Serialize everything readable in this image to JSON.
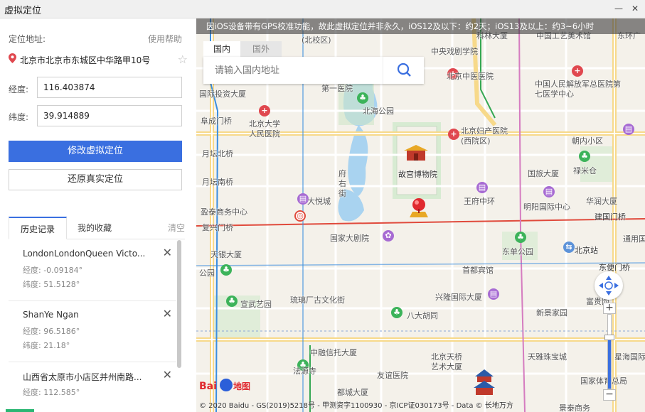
{
  "window": {
    "title": "虚拟定位",
    "min_label": "—",
    "close_label": "✕"
  },
  "location": {
    "label": "定位地址:",
    "help": "使用帮助",
    "address": "北京市北京市东城区中华路甲10号",
    "lng_label": "经度:",
    "lng_value": "116.403874",
    "lat_label": "纬度:",
    "lat_value": "39.914889"
  },
  "buttons": {
    "modify": "修改虚拟定位",
    "restore": "还原真实定位"
  },
  "tabs": {
    "history": "历史记录",
    "favorites": "我的收藏",
    "clear": "清空"
  },
  "history": [
    {
      "name": "LondonLondonQueen Victo...",
      "lng": "经度:  -0.09184°",
      "lat": "纬度:  51.5128°"
    },
    {
      "name": "ShanYe Ngan",
      "lng": "经度:  96.5186°",
      "lat": "纬度:  21.18°"
    },
    {
      "name": "山西省太原市小店区并州南路...",
      "lng": "经度:  112.585°",
      "lat": ""
    }
  ],
  "map": {
    "notice": "因iOS设备带有GPS校准功能，故此虚拟定位并非永久，iOS12及以下：约2天；iOS13及以上：约3~6小时",
    "search_tab_domestic": "国内",
    "search_tab_abroad": "国外",
    "search_placeholder": "请输入国内地址",
    "copyright": "© 2020 Baidu - GS(2019)5218号 - 甲测资字1100930 - 京ICP证030173号 - Data © 长地万方",
    "logo": "Bai地图",
    "labels": {
      "l1": "(北校区)",
      "l2": "中央戏剧学院",
      "l3": "科林大厦",
      "l4": "中国工艺美术馆",
      "l5": "东环广",
      "l6": "北京中医医院",
      "l7": "第一医院",
      "l8": "国际投资大厦",
      "l9": "北海公园",
      "l10": "中国人民解放军总医院第七医学中心",
      "l11": "北京大学人民医院",
      "l12": "阜成门桥",
      "l13": "北京妇产医院(西院区)",
      "l14": "朝内小区",
      "l15": "月坛北桥",
      "l16": "故宫博物院",
      "l17": "国旅大厦",
      "l18": "禄米仓",
      "l19": "府右街",
      "l20": "月坛南桥",
      "l21": "大悦城",
      "l22": "王府中环",
      "l23": "华润大厦",
      "l24": "盈泰商务中心",
      "l25": "明阳国际中心",
      "l26": "建国门桥",
      "l27": "复兴门桥",
      "l28": "国家大剧院",
      "l29": "通用国际",
      "l30": "天银大厦",
      "l31": "东单公园",
      "l32": "北京站",
      "l33": "首都宾馆",
      "l34": "东便门桥",
      "l35": "公园",
      "l36": "兴隆国际大厦",
      "l37": "宣武艺园",
      "l38": "琉璃厂古文化街",
      "l39": "富贵园",
      "l40": "八大胡同",
      "l41": "新景家园",
      "l42": "中融信托大厦",
      "l43": "北京天桥艺术大厦",
      "l44": "天雅珠宝城",
      "l45": "法源寺",
      "l46": "友谊医院",
      "l47": "星海国际",
      "l48": "都城大厦",
      "l49": "国家体育总局",
      "l50": "景泰商务"
    }
  }
}
